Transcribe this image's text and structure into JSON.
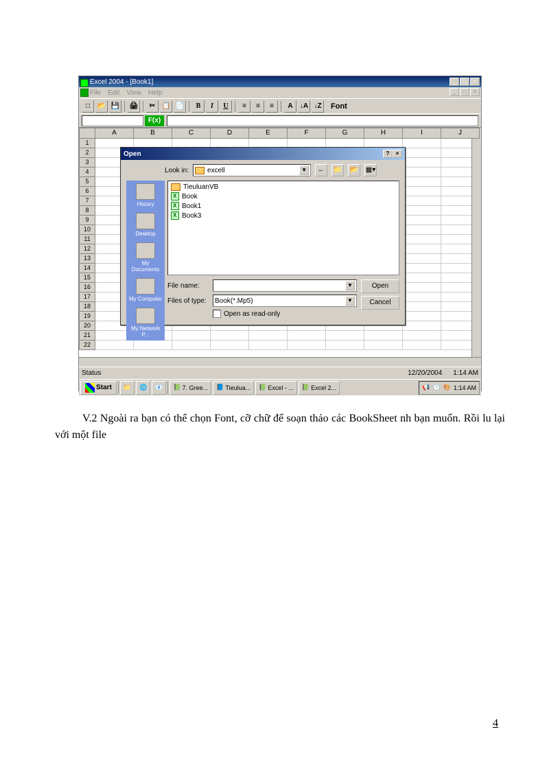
{
  "app": {
    "title": "Excel 2004 - [Book1]",
    "menu": [
      "File",
      "Edit",
      "View",
      "Help"
    ],
    "font_label": "Font",
    "fx_label": "F(x)",
    "columns": [
      "A",
      "B",
      "C",
      "D",
      "E",
      "F",
      "G",
      "H",
      "I",
      "J"
    ],
    "row_count": 22,
    "status": "Status",
    "date": "12/20/2004",
    "time": "1:14 AM"
  },
  "dialog": {
    "title": "Open",
    "lookin_label": "Look in:",
    "lookin_value": "excell",
    "places": [
      "History",
      "Desktop",
      "My Documents",
      "My Computer",
      "My Network P..."
    ],
    "files": [
      {
        "name": "TieuluanVB",
        "type": "folder"
      },
      {
        "name": "Book",
        "type": "file"
      },
      {
        "name": "Book1",
        "type": "file"
      },
      {
        "name": "Book3",
        "type": "file"
      }
    ],
    "filename_label": "File name:",
    "filename_value": "",
    "filetype_label": "Files of type:",
    "filetype_value": "Book(*.Mp5)",
    "readonly_label": "Open as read-only",
    "open_btn": "Open",
    "cancel_btn": "Cancel"
  },
  "taskbar": {
    "start": "Start",
    "items": [
      "7. Gree...",
      "Tieulua...",
      "Excel - ...",
      "Excel 2..."
    ],
    "tray_time": "1:14 AM"
  },
  "body": {
    "para": "V.2 Ngoài ra bạn có thể chọn Font, cỡ chữ để soạn thảo các BookSheet nh   bạn muốn. Rồi lu   lại với một file"
  },
  "page_number": "4"
}
